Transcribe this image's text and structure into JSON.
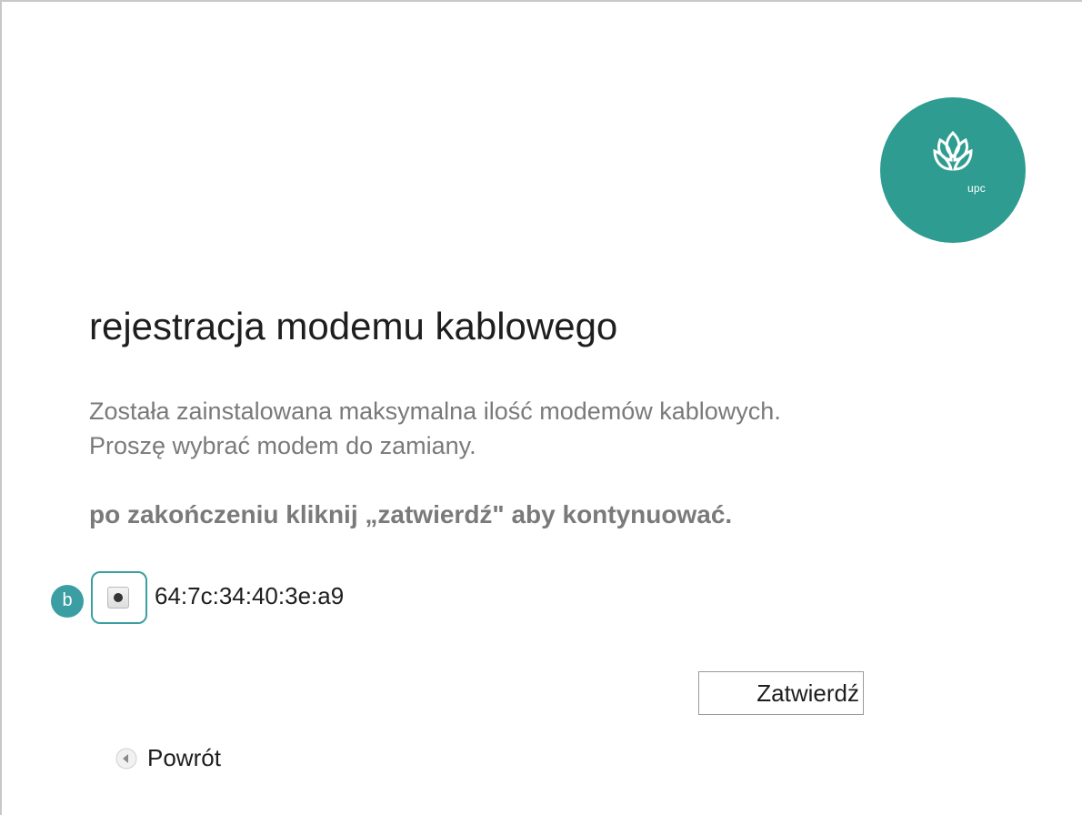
{
  "logo": {
    "text": "upc",
    "icon": "upc-flower-icon",
    "color": "#2e9c91"
  },
  "page": {
    "title": "rejestracja modemu kablowego",
    "description_line1": "Została zainstalowana maksymalna ilość modemów kablowych.",
    "description_line2": "Proszę wybrać modem do zamiany.",
    "instruction": "po zakończeniu kliknij „zatwierdź\" aby kontynuować."
  },
  "annotation": {
    "badge": "b",
    "color": "#3a9ea3"
  },
  "modems": [
    {
      "mac": "64:7c:34:40:3e:a9",
      "selected": true
    }
  ],
  "actions": {
    "submit_label": "Zatwierdź",
    "back_label": "Powrót",
    "back_icon": "back-arrow-icon"
  }
}
